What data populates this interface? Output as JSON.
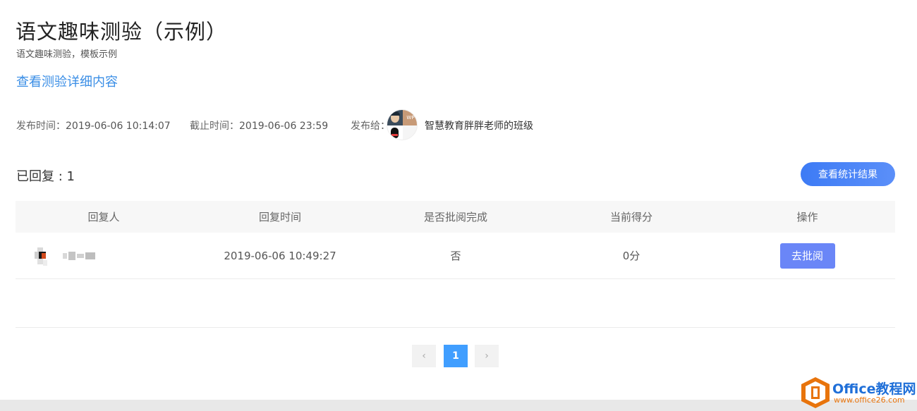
{
  "header": {
    "title": "语文趣味测验（示例）",
    "subtitle": "语文趣味测验，模板示例",
    "detail_link": "查看测验详细内容"
  },
  "meta": {
    "publish_label": "发布时间：",
    "publish_value": "2019-06-06 10:14:07",
    "deadline_label": "截止时间：",
    "deadline_value": "2019-06-06 23:59",
    "target_label": "发布给：",
    "target_name": "智慧教育胖胖老师的班级"
  },
  "summary": {
    "replied": "已回复 : 1",
    "stats_button": "查看统计结果"
  },
  "table": {
    "headers": [
      "回复人",
      "回复时间",
      "是否批阅完成",
      "当前得分",
      "操作"
    ],
    "rows": [
      {
        "replier": "",
        "time": "2019-06-06 10:49:27",
        "reviewed": "否",
        "score": "0分",
        "action": "去批阅"
      }
    ]
  },
  "pagination": {
    "prev": "‹",
    "current": "1",
    "next": "›"
  },
  "watermark": {
    "brand": "Office教程网",
    "url": "www.office26.com"
  },
  "colors": {
    "link": "#3a8ee6",
    "primary_button": "#3d7bf5",
    "review_button": "#6a86f7",
    "page_active": "#409eff"
  }
}
